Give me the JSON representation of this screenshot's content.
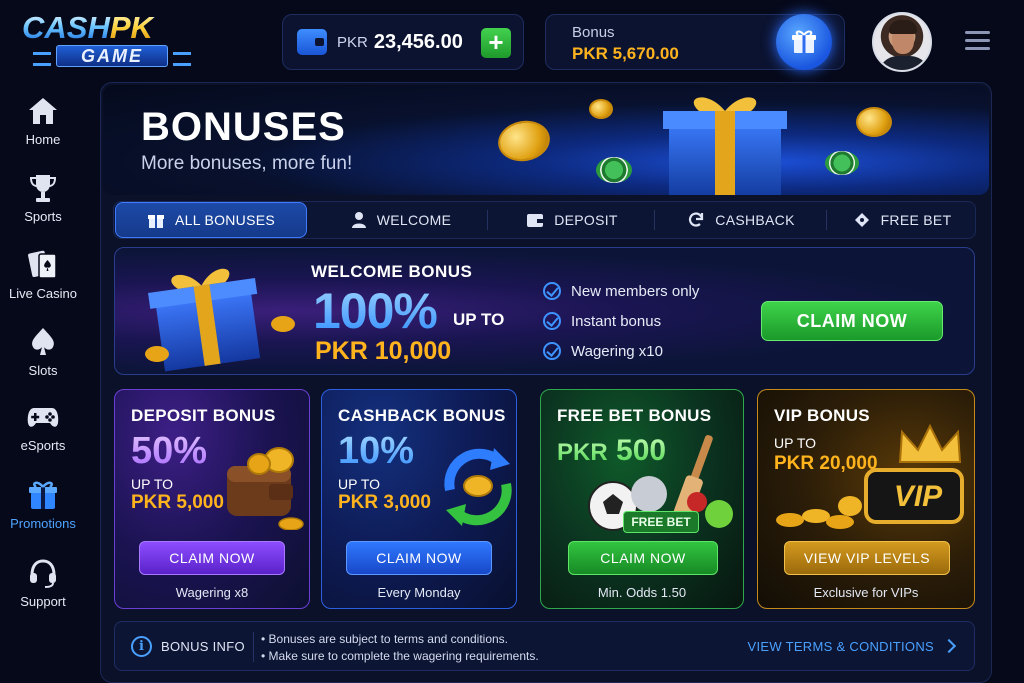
{
  "brand": {
    "logo_top_a": "CASH",
    "logo_top_b": "PK",
    "logo_bottom": "GAME"
  },
  "wallet": {
    "currency": "PKR",
    "amount": "23,456.00",
    "add_label": "+"
  },
  "bonus": {
    "label": "Bonus",
    "amount": "PKR 5,670.00"
  },
  "sidebar": {
    "items": [
      {
        "label": "Home",
        "icon": "home-icon"
      },
      {
        "label": "Sports",
        "icon": "trophy-icon"
      },
      {
        "label": "Live Casino",
        "icon": "cards-icon"
      },
      {
        "label": "Slots",
        "icon": "spade-icon"
      },
      {
        "label": "eSports",
        "icon": "gamepad-icon"
      },
      {
        "label": "Promotions",
        "icon": "gift-icon",
        "active": true
      },
      {
        "label": "Support",
        "icon": "headset-icon"
      }
    ]
  },
  "hero": {
    "title": "BONUSES",
    "subtitle": "More bonuses, more fun!"
  },
  "tabs": [
    {
      "label": "ALL BONUSES",
      "icon": "gift-icon",
      "active": true
    },
    {
      "label": "WELCOME",
      "icon": "user-icon"
    },
    {
      "label": "DEPOSIT",
      "icon": "wallet-icon"
    },
    {
      "label": "CASHBACK",
      "icon": "refresh-icon"
    },
    {
      "label": "FREE BET",
      "icon": "ticket-icon"
    }
  ],
  "welcome": {
    "title": "WELCOME BONUS",
    "percent": "100%",
    "upto": "UP TO",
    "amount": "PKR 10,000",
    "features": [
      "New members only",
      "Instant bonus",
      "Wagering x10"
    ],
    "cta": "CLAIM NOW"
  },
  "cards": [
    {
      "title": "DEPOSIT BONUS",
      "big": "50%",
      "upto": "UP TO",
      "amount": "PKR 5,000",
      "cta": "CLAIM NOW",
      "note": "Wagering x8"
    },
    {
      "title": "CASHBACK BONUS",
      "big": "10%",
      "upto": "UP TO",
      "amount": "PKR 3,000",
      "cta": "CLAIM NOW",
      "note": "Every Monday"
    },
    {
      "title": "FREE BET BONUS",
      "big_prefix": "PKR",
      "big": "500",
      "badge": "FREE BET",
      "cta": "CLAIM NOW",
      "note": "Min. Odds 1.50"
    },
    {
      "title": "VIP BONUS",
      "upto": "UP TO",
      "amount": "PKR 20,000",
      "vip_badge": "VIP",
      "cta": "VIEW VIP LEVELS",
      "note": "Exclusive for VIPs"
    }
  ],
  "info": {
    "label": "BONUS INFO",
    "lines": [
      "• Bonuses are subject to terms and conditions.",
      "• Make sure to complete the wagering requirements."
    ],
    "link": "VIEW TERMS & CONDITIONS"
  },
  "colors": {
    "accent_blue": "#3d93ff",
    "gold": "#ffb41e",
    "green": "#32c440",
    "purple": "#8d4dff",
    "background": "#06091a"
  }
}
